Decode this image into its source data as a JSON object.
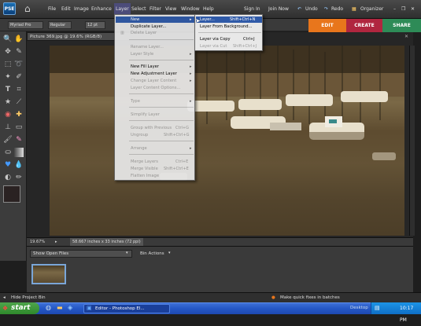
{
  "app": {
    "logo_text": "PSE"
  },
  "menubar": {
    "items": [
      "File",
      "Edit",
      "Image",
      "Enhance",
      "Layer",
      "Select",
      "Filter",
      "View",
      "Window",
      "Help"
    ],
    "active": "Layer",
    "right": {
      "sign_in": "Sign In",
      "join_now": "Join Now",
      "undo": "Undo",
      "redo": "Redo",
      "organizer": "Organizer"
    }
  },
  "options_bar": {
    "font": "Myriad Pro",
    "style": "Regular",
    "size": "12 pt"
  },
  "mode_tabs": [
    {
      "label": "EDIT",
      "color": "#e8761c"
    },
    {
      "label": "CREATE",
      "color": "#b0263f"
    },
    {
      "label": "SHARE",
      "color": "#2e8b57"
    }
  ],
  "document": {
    "tab_title": "Picture 369.jpg @ 19.6% (RGB/8)",
    "zoom": "19.67%",
    "dimensions": "58.667 inches x 33 inches (72 ppi)"
  },
  "layer_menu": {
    "items": [
      {
        "label": "New",
        "submenu": true,
        "enabled": true,
        "highlighted": true
      },
      {
        "label": "Duplicate Layer...",
        "enabled": true
      },
      {
        "label": "Delete Layer",
        "enabled": false
      },
      {
        "label": "Rename Layer...",
        "enabled": false
      },
      {
        "label": "Layer Style",
        "submenu": true,
        "enabled": false
      },
      {
        "label": "New Fill Layer",
        "submenu": true,
        "enabled": true
      },
      {
        "label": "New Adjustment Layer",
        "submenu": true,
        "enabled": true
      },
      {
        "label": "Change Layer Content",
        "submenu": true,
        "enabled": false
      },
      {
        "label": "Layer Content Options...",
        "enabled": false
      },
      {
        "label": "Type",
        "submenu": true,
        "enabled": false
      },
      {
        "label": "Simplify Layer",
        "enabled": false
      },
      {
        "label": "Group with Previous",
        "shortcut": "Ctrl+G",
        "enabled": false
      },
      {
        "label": "Ungroup",
        "shortcut": "Shift+Ctrl+G",
        "enabled": false
      },
      {
        "label": "Arrange",
        "submenu": true,
        "enabled": false
      },
      {
        "label": "Merge Layers",
        "shortcut": "Ctrl+E",
        "enabled": false
      },
      {
        "label": "Merge Visible",
        "shortcut": "Shift+Ctrl+E",
        "enabled": false
      },
      {
        "label": "Flatten Image",
        "enabled": false
      }
    ]
  },
  "new_submenu": {
    "items": [
      {
        "label": "Layer...",
        "shortcut": "Shift+Ctrl+N",
        "enabled": true,
        "highlighted": true
      },
      {
        "label": "Layer From Background...",
        "enabled": true
      },
      {
        "label": "Layer via Copy",
        "shortcut": "Ctrl+J",
        "enabled": true
      },
      {
        "label": "Layer via Cut",
        "shortcut": "Shift+Ctrl+J",
        "enabled": false
      }
    ]
  },
  "bin": {
    "show_dropdown": "Show Open Files",
    "actions": "Bin Actions"
  },
  "bottom_strip": {
    "hide_bin": "Hide Project Bin",
    "hint": "Make quick fixes in batches"
  },
  "taskbar": {
    "start": "start",
    "task": "Editor - Photoshop El...",
    "desktop": "Desktop",
    "clock": "10:17 PM"
  },
  "colors": {
    "menu_highlight": "#2f5aa8",
    "edit_tab": "#e8761c",
    "create_tab": "#b0263f",
    "share_tab": "#2e8b57"
  }
}
